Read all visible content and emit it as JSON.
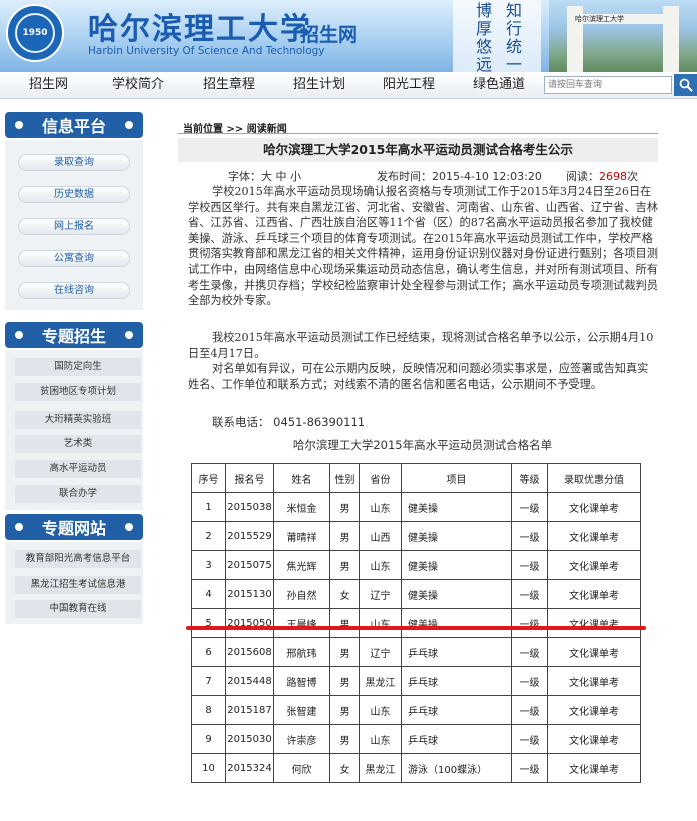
{
  "header": {
    "cn_name": "哈尔滨理工大学",
    "en_name": "Harbin University Of Science And Technology",
    "site_label": "招生网",
    "calligraphy": [
      "知行统一",
      "博厚悠远"
    ],
    "gate_text": "哈尔滨理工大学",
    "logo_text": "1950"
  },
  "nav": {
    "items": [
      "招生网",
      "学校简介",
      "招生章程",
      "招生计划",
      "阳光工程",
      "绿色通道"
    ],
    "search_placeholder": "请按回车查询"
  },
  "sidebar": {
    "platform": {
      "title": "信息平台",
      "items": [
        "录取查询",
        "历史数据",
        "网上报名",
        "公寓查询",
        "在线咨询"
      ]
    },
    "special": {
      "title": "专题招生",
      "items": [
        "国防定向生",
        "贫困地区专项计划",
        "大珩精英实验班",
        "艺术类",
        "高水平运动员",
        "联合办学"
      ]
    },
    "sites": {
      "title": "专题网站",
      "items": [
        "教育部阳光高考信息平台",
        "黑龙江招生考试信息港",
        "中国教育在线"
      ]
    }
  },
  "article": {
    "breadcrumb": "当前位置 >> 阅读新闻",
    "title": "哈尔滨理工大学2015年高水平运动员测试合格考生公示",
    "font_label": "字体：大 中 小",
    "publish_label": "发布时间：",
    "publish_time": "2015-4-10 12:03:20",
    "views_label": "阅读：",
    "views": "2698",
    "views_unit": "次",
    "para1": "学校2015年高水平运动员现场确认报名资格与专项测试工作于2015年3月24日至26日在学校西区举行。共有来自黑龙江省、河北省、安徽省、河南省、山东省、山西省、辽宁省、吉林省、江苏省、江西省、广西壮族自治区等11个省（区）的87名高水平运动员报名参加了我校健美操、游泳、乒乓球三个项目的体育专项测试。在2015年高水平运动员测试工作中，学校严格贯彻落实教育部和黑龙江省的相关文件精神，运用身份证识别仪器对身份证进行甄别；各项目测试工作中，由网络信息中心现场采集运动员动态信息，确认考生信息，并对所有测试项目、所有考生录像，并携贝存档；学校纪检监察审计处全程参与测试工作；高水平运动员专项测试裁判员全部为校外专家。",
    "para2": "我校2015年高水平运动员测试工作已经结束，现将测试合格名单予以公示，公示期4月10日至4月17日。",
    "para3": "对名单如有异议，可在公示期内反映，反映情况和问题必须实事求是，应签署或告知真实姓名、工作单位和联系方式；对线索不清的匿名信和匿名电话，公示期间不予受理。",
    "phone": "联系电话： 0451-86390111",
    "table_title": "哈尔滨理工大学2015年高水平运动员测试合格名单"
  },
  "table": {
    "headers": [
      "序号",
      "报名号",
      "姓名",
      "性别",
      "省份",
      "项目",
      "等级",
      "录取优惠分值"
    ],
    "rows": [
      [
        "1",
        "2015038",
        "米恒金",
        "男",
        "山东",
        "健美操",
        "一级",
        "文化课单考"
      ],
      [
        "2",
        "2015529",
        "莆晴祥",
        "男",
        "山西",
        "健美操",
        "一级",
        "文化课单考"
      ],
      [
        "3",
        "2015075",
        "焦光辉",
        "男",
        "山东",
        "健美操",
        "一级",
        "文化课单考"
      ],
      [
        "4",
        "2015130",
        "孙自然",
        "女",
        "辽宁",
        "健美操",
        "一级",
        "文化课单考"
      ],
      [
        "5",
        "2015050",
        "王晨峰",
        "男",
        "山东",
        "健美操",
        "一级",
        "文化课单考"
      ],
      [
        "6",
        "2015608",
        "邢航玮",
        "男",
        "辽宁",
        "乒乓球",
        "一级",
        "文化课单考"
      ],
      [
        "7",
        "2015448",
        "路智博",
        "男",
        "黑龙江",
        "乒乓球",
        "一级",
        "文化课单考"
      ],
      [
        "8",
        "2015187",
        "张智建",
        "男",
        "山东",
        "乒乓球",
        "一级",
        "文化课单考"
      ],
      [
        "9",
        "2015030",
        "许崇彦",
        "男",
        "山东",
        "乒乓球",
        "一级",
        "文化课单考"
      ],
      [
        "10",
        "2015324",
        "何欣",
        "女",
        "黑龙江",
        "游泳（100蝶泳）",
        "一级",
        "文化课单考"
      ]
    ]
  },
  "colors": {
    "brand_blue": "#2160a6",
    "highlight_red": "#e0181b",
    "views_red": "#cc0000"
  }
}
